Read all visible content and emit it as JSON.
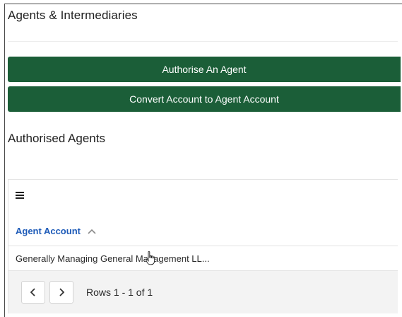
{
  "page": {
    "title": "Agents & Intermediaries"
  },
  "actions": {
    "authorise_label": "Authorise An Agent",
    "convert_label": "Convert Account to Agent Account"
  },
  "authorised_agents": {
    "title": "Authorised Agents",
    "menu_icon": "hamburger-menu-icon",
    "column_header": "Agent Account",
    "sort_icon": "chevron-up-icon",
    "rows": [
      "Generally Managing General Management LL..."
    ],
    "pager": {
      "prev_icon": "chevron-left-icon",
      "next_icon": "chevron-right-icon",
      "rows_text": "Rows 1 - 1 of 1"
    }
  },
  "colors": {
    "button_green": "#1b5e38",
    "header_blue": "#1e5bb8"
  }
}
